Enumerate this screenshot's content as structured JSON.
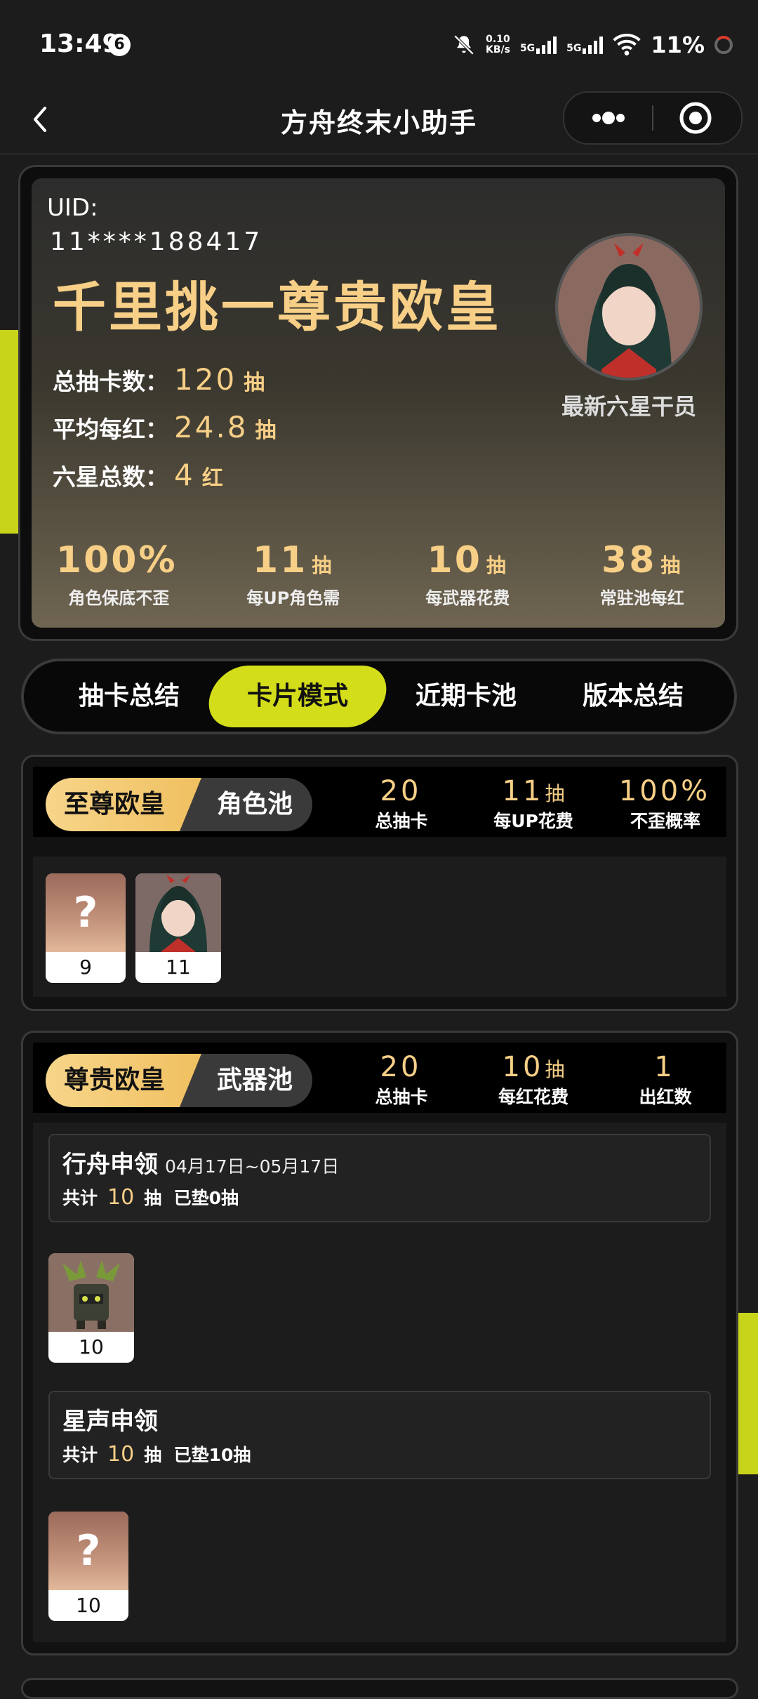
{
  "status_bar": {
    "time": "13:49",
    "badge": "6",
    "speed_value": "0.10",
    "speed_unit": "KB/s",
    "net1": "5G",
    "net2": "5G",
    "battery": "11%"
  },
  "header": {
    "title": "方舟终末小助手",
    "more_icon": "more-dots-icon",
    "close_icon": "target-close-icon"
  },
  "summary": {
    "uid_label": "UID:",
    "uid_value": "11****188417",
    "rank_title": "千里挑一尊贵欧皇",
    "total_label": "总抽卡数：",
    "total_value": "120",
    "total_unit": "抽",
    "avg_label": "平均每红：",
    "avg_value": "24.8",
    "avg_unit": "抽",
    "six_label": "六星总数：",
    "six_value": "4",
    "six_unit": "红",
    "avatar_label": "最新六星干员",
    "stats": [
      {
        "value": "100%",
        "unit": "",
        "label": "角色保底不歪"
      },
      {
        "value": "11",
        "unit": "抽",
        "label": "每UP角色需"
      },
      {
        "value": "10",
        "unit": "抽",
        "label": "每武器花费"
      },
      {
        "value": "38",
        "unit": "抽",
        "label": "常驻池每红"
      }
    ]
  },
  "tabs": [
    {
      "label": "抽卡总结"
    },
    {
      "label": "卡片模式"
    },
    {
      "label": "近期卡池"
    },
    {
      "label": "版本总结"
    }
  ],
  "character_pool": {
    "rank": "至尊欧皇",
    "pool_name": "角色池",
    "stats": [
      {
        "value": "20",
        "unit": "",
        "label": "总抽卡"
      },
      {
        "value": "11",
        "unit": "抽",
        "label": "每UP花费"
      },
      {
        "value": "100%",
        "unit": "",
        "label": "不歪概率"
      }
    ],
    "cards": [
      {
        "symbol": "?",
        "count": "9"
      },
      {
        "symbol": "",
        "count": "11"
      }
    ]
  },
  "weapon_pool": {
    "rank": "尊贵欧皇",
    "pool_name": "武器池",
    "stats": [
      {
        "value": "20",
        "unit": "",
        "label": "总抽卡"
      },
      {
        "value": "10",
        "unit": "抽",
        "label": "每红花费"
      },
      {
        "value": "1",
        "unit": "",
        "label": "出红数"
      }
    ],
    "banners": [
      {
        "name": "行舟申领",
        "date": "04月17日~05月17日",
        "prefix": "共计",
        "count": "10",
        "suffix": "抽  已垫0抽",
        "card_count": "10"
      },
      {
        "name": "星声申领",
        "date": "",
        "prefix": "共计",
        "count": "10",
        "suffix": "抽  已垫10抽",
        "card_symbol": "?",
        "card_count": "10"
      }
    ]
  },
  "colors": {
    "accent_yellow": "#d4dd1a",
    "gold_text": "#f7cf86",
    "background": "#1c1c1c"
  }
}
